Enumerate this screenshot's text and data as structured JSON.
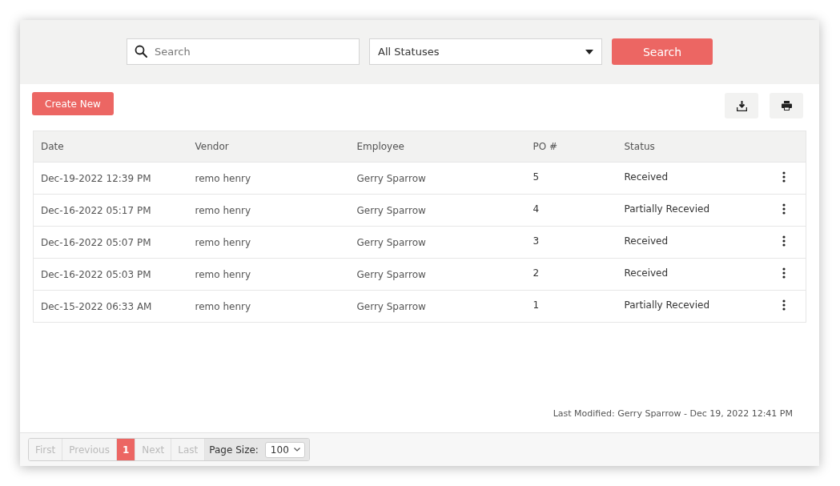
{
  "filter_bar": {
    "search": {
      "placeholder": "Search"
    },
    "status_select": {
      "value": "All Statuses"
    },
    "search_button": "Search"
  },
  "create_button": "Create New",
  "table": {
    "columns": [
      "Date",
      "Vendor",
      "Employee",
      "PO #",
      "Status"
    ],
    "rows": [
      {
        "date": "Dec-19-2022 12:39 PM",
        "vendor": "remo henry",
        "employee": "Gerry Sparrow",
        "po": "5",
        "status": "Received"
      },
      {
        "date": "Dec-16-2022 05:17 PM",
        "vendor": "remo henry",
        "employee": "Gerry Sparrow",
        "po": "4",
        "status": "Partially Recevied"
      },
      {
        "date": "Dec-16-2022 05:07 PM",
        "vendor": "remo henry",
        "employee": "Gerry Sparrow",
        "po": "3",
        "status": "Received"
      },
      {
        "date": "Dec-16-2022 05:03 PM",
        "vendor": "remo henry",
        "employee": "Gerry Sparrow",
        "po": "2",
        "status": "Received"
      },
      {
        "date": "Dec-15-2022 06:33 AM",
        "vendor": "remo henry",
        "employee": "Gerry Sparrow",
        "po": "1",
        "status": "Partially Recevied"
      }
    ]
  },
  "last_modified": "Last Modified: Gerry Sparrow - Dec 19, 2022 12:41 PM",
  "pager": {
    "items": [
      {
        "label": "First",
        "kind": "nav",
        "disabled": true,
        "selected": false
      },
      {
        "label": "Previous",
        "kind": "nav",
        "disabled": true,
        "selected": false
      },
      {
        "label": "1",
        "kind": "page",
        "disabled": false,
        "selected": true
      },
      {
        "label": "Next",
        "kind": "nav",
        "disabled": true,
        "selected": false
      },
      {
        "label": "Last",
        "kind": "nav",
        "disabled": true,
        "selected": false
      }
    ],
    "page_size_label": "Page Size:",
    "page_size": "100"
  }
}
